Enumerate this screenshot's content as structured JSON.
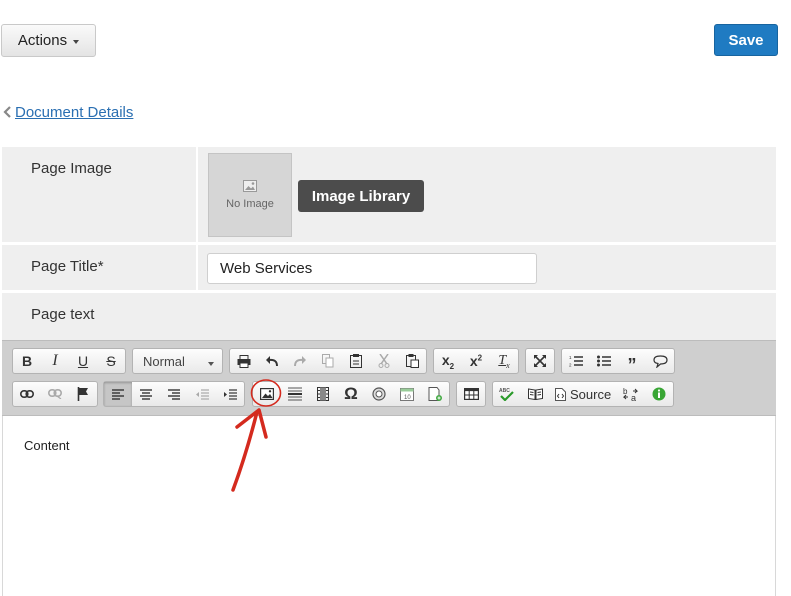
{
  "header": {
    "actions_label": "Actions",
    "save_label": "Save"
  },
  "breadcrumb": {
    "back_label": "Document Details"
  },
  "form": {
    "page_image_label": "Page Image",
    "no_image_text": "No Image",
    "image_library_label": "Image Library",
    "page_title_label": "Page Title*",
    "page_title_value": "Web Services",
    "page_text_label": "Page text"
  },
  "editor": {
    "format_value": "Normal",
    "source_label": "Source",
    "content_text": "Content",
    "icons_row1": [
      "bold-icon",
      "italic-icon",
      "underline-icon",
      "strikethrough-icon",
      "print-icon",
      "undo-icon",
      "redo-icon",
      "copy-icon",
      "paste-icon",
      "cut-icon",
      "paste-text-icon",
      "subscript-icon",
      "superscript-icon",
      "remove-format-icon",
      "maximize-icon",
      "numbered-list-icon",
      "bullet-list-icon",
      "blockquote-icon",
      "comment-icon"
    ],
    "icons_row2": [
      "link-icon",
      "unlink-icon",
      "anchor-flag-icon",
      "align-left-icon",
      "align-center-icon",
      "align-right-icon",
      "outdent-icon",
      "indent-icon",
      "image-icon",
      "horizontal-line-icon",
      "film-icon",
      "omega-icon",
      "iframe-icon",
      "calendar-icon",
      "template-icon",
      "table-icon",
      "spellcheck-icon",
      "book-icon",
      "source-icon",
      "language-direction-icon",
      "info-icon"
    ]
  },
  "colors": {
    "primary": "#1f7bc2",
    "dark_button": "#4c4c4c",
    "annotation": "#d42a1e",
    "link": "#2a6fb2"
  }
}
